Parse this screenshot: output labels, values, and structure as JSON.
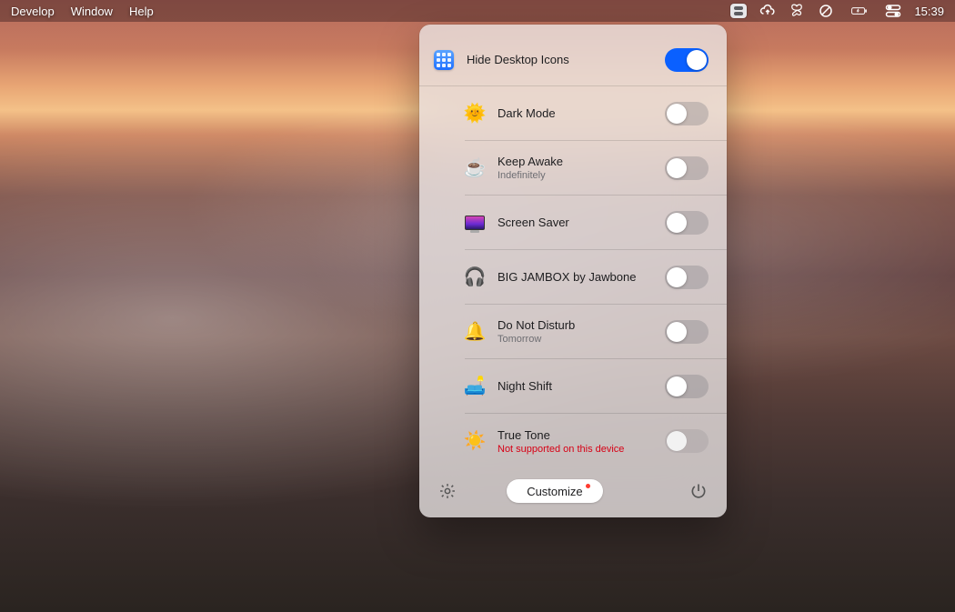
{
  "menubar": {
    "left": [
      "Develop",
      "Window",
      "Help"
    ],
    "clock": "15:39"
  },
  "panel": {
    "items": [
      {
        "icon": "grid",
        "label": "Hide Desktop Icons",
        "sub": "",
        "state": "on",
        "sub_error": false
      },
      {
        "icon": "sun",
        "label": "Dark Mode",
        "sub": "",
        "state": "off",
        "sub_error": false
      },
      {
        "icon": "coffee",
        "label": "Keep Awake",
        "sub": "Indefinitely",
        "state": "off",
        "sub_error": false
      },
      {
        "icon": "screensaver",
        "label": "Screen Saver",
        "sub": "",
        "state": "off",
        "sub_error": false
      },
      {
        "icon": "headphones",
        "label": "BIG JAMBOX by Jawbone",
        "sub": "",
        "state": "off",
        "sub_error": false
      },
      {
        "icon": "bell",
        "label": "Do Not Disturb",
        "sub": "Tomorrow",
        "state": "off",
        "sub_error": false
      },
      {
        "icon": "lamp",
        "label": "Night Shift",
        "sub": "",
        "state": "off",
        "sub_error": false
      },
      {
        "icon": "sun2",
        "label": "True Tone",
        "sub": "Not supported on this device",
        "state": "disabled",
        "sub_error": true
      }
    ],
    "footer": {
      "customize_label": "Customize",
      "has_badge": true
    }
  }
}
